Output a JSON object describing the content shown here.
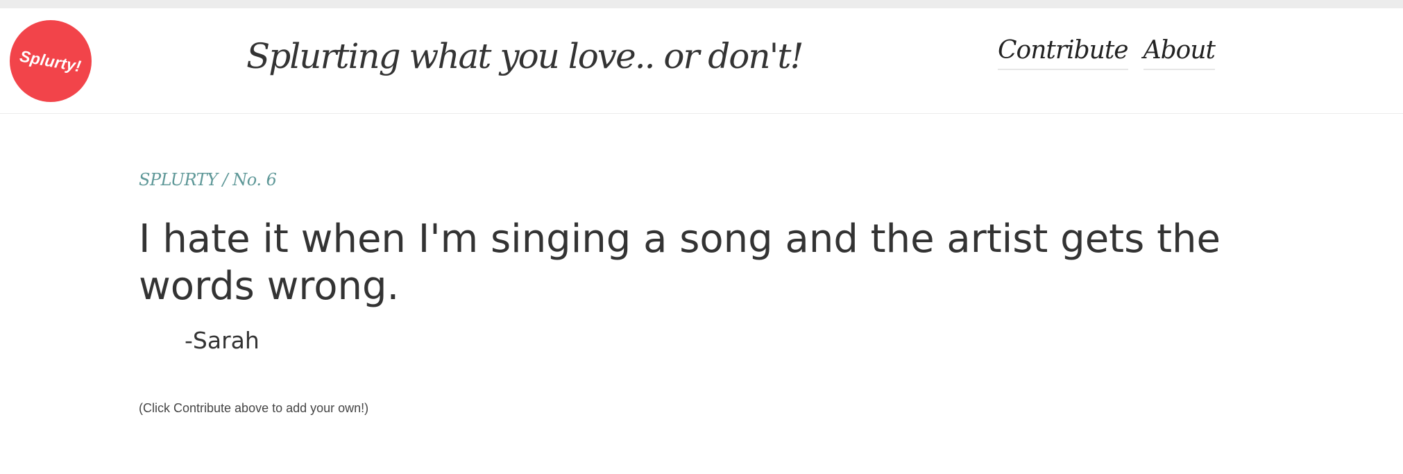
{
  "header": {
    "logo_text": "Splurty!",
    "tagline": "Splurting what you love.. or don't!",
    "nav": {
      "contribute_label": "Contribute",
      "about_label": "About"
    }
  },
  "main": {
    "breadcrumb": "SPLURTY / No. 6",
    "quote": "I hate it when I'm singing a song and the artist gets the words wrong.",
    "author": "-Sarah",
    "hint": "(Click Contribute above to add your own!)"
  },
  "colors": {
    "logo_background": "#f2444a",
    "breadcrumb": "#5f9898",
    "text": "#333333"
  }
}
